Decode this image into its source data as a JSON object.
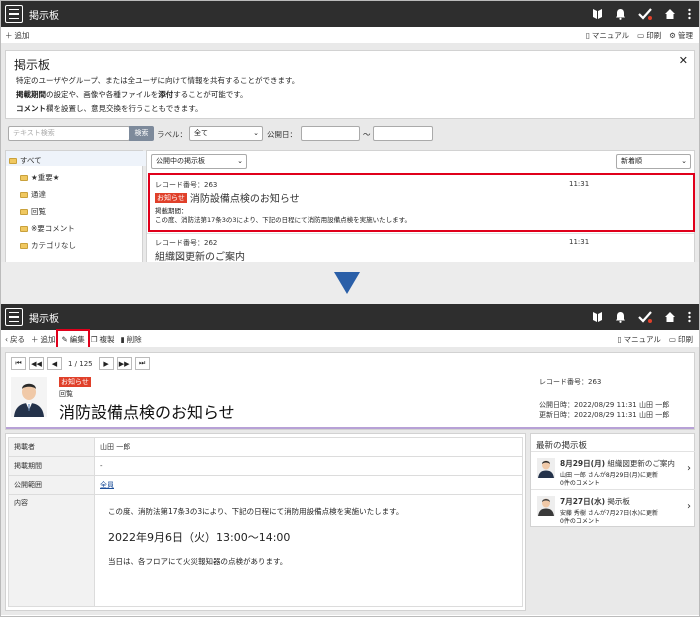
{
  "top": {
    "app_title": "掲示板",
    "add_label": "追加",
    "manual_label": "マニュアル",
    "print_label": "印刷",
    "manage_label": "管理",
    "info": {
      "title": "掲示板",
      "line1": "特定のユーザやグループ、または全ユーザに向けて情報を共有することができます。",
      "line2_bold": "掲載期間",
      "line2_rest": "の設定や、画像や各種ファイルを",
      "line2_bold2": "添付",
      "line2_end": "することが可能です。",
      "line3_bold": "コメント",
      "line3_rest": "欄を設置し、意見交換を行うこともできます。"
    },
    "search_placeholder": "テキスト検索",
    "search_button": "検索",
    "label_label": "ラベル：",
    "label_value": "全て",
    "public_date_label": "公開日：",
    "tilde": "～",
    "tree": [
      "すべて",
      "★重要★",
      "通達",
      "回覧",
      "※要コメント",
      "カテゴリなし"
    ],
    "filter_value": "公開中の掲示板",
    "sort_value": "新着順",
    "records": [
      {
        "num": "レコード番号：263",
        "time": "11:31",
        "badge": "お知らせ",
        "title": "消防設備点検のお知らせ",
        "period_label": "掲載期間：",
        "body": "この度、消防法第17条3の3により、下記の日程にて消防用設備点検を実施いたします。"
      },
      {
        "num": "レコード番号：262",
        "time": "11:31",
        "title": "組織図更新のご案内"
      }
    ]
  },
  "bottom": {
    "app_title": "掲示板",
    "back_label": "戻る",
    "add_label": "追加",
    "edit_label": "編集",
    "copy_label": "複製",
    "delete_label": "削除",
    "manual_label": "マニュアル",
    "print_label": "印刷",
    "pager_text": "1 / 125",
    "badge": "お知らせ",
    "category": "回覧",
    "title": "消防設備点検のお知らせ",
    "record_num": "レコード番号：263",
    "published": "公開日時：2022/08/29 11:31 山田 一郎",
    "updated": "更新日時：2022/08/29 11:31 山田 一郎",
    "fields": {
      "poster_label": "掲載者",
      "poster_value": "山田 一郎",
      "period_label": "掲載期間",
      "period_value": "-",
      "scope_label": "公開範囲",
      "scope_value": "全員",
      "content_label": "内容"
    },
    "content": {
      "line1": "この度、消防法第17条3の3により、下記の日程にて消防用設備点検を実施いたします。",
      "line2": "2022年9月6日（火）13:00～14:00",
      "line3": "当日は、各フロアにて火災報知器の点検があります。"
    },
    "latest": {
      "title": "最新の掲示板",
      "items": [
        {
          "date": "8月29日(月)",
          "title": "組織図更新のご案内",
          "meta": "山田 一郎 さんが8月29日(月)に更新",
          "comments": "0件のコメント"
        },
        {
          "date": "7月27日(水)",
          "title": "掲示板",
          "meta": "安藤 秀樹 さんが7月27日(水)に更新",
          "comments": "0件のコメント"
        }
      ]
    }
  }
}
